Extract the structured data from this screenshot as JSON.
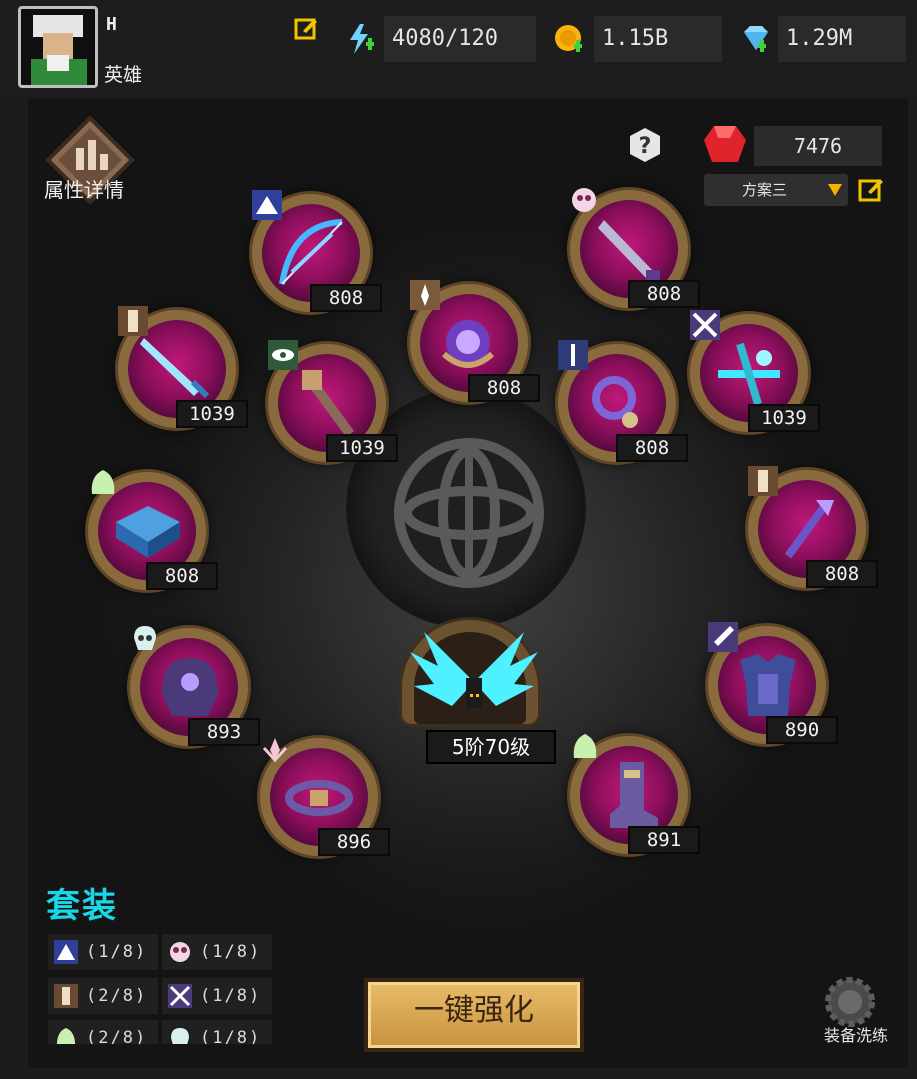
{
  "player": {
    "name": "H",
    "title": "英雄"
  },
  "resources": {
    "stamina": "4080/120",
    "gold": "1.15B",
    "diamonds": "1.29M"
  },
  "panel": {
    "attributes_label": "属性详情",
    "ruby_count": "7476",
    "plan_selected": "方案三"
  },
  "slots": [
    {
      "name": "bow",
      "level": "808"
    },
    {
      "name": "blade",
      "level": "808"
    },
    {
      "name": "sword",
      "level": "1039"
    },
    {
      "name": "crossbow",
      "level": "1039"
    },
    {
      "name": "orb",
      "level": "808"
    },
    {
      "name": "staff",
      "level": "1039"
    },
    {
      "name": "ring",
      "level": "808"
    },
    {
      "name": "book",
      "level": "808"
    },
    {
      "name": "scepter",
      "level": "808"
    },
    {
      "name": "helmet",
      "level": "893"
    },
    {
      "name": "armor",
      "level": "890"
    },
    {
      "name": "belt",
      "level": "896"
    },
    {
      "name": "boots",
      "level": "891"
    }
  ],
  "wings": {
    "level": "5阶70级"
  },
  "sets": {
    "title": "套装",
    "entries": [
      {
        "icon": "mountain-icon",
        "count": "(1/8)"
      },
      {
        "icon": "skull-sword-icon",
        "count": "(1/8)"
      },
      {
        "icon": "banner-icon",
        "count": "(2/8)"
      },
      {
        "icon": "crossed-swords-icon",
        "count": "(1/8)"
      },
      {
        "icon": "hood-icon",
        "count": "(2/8)"
      },
      {
        "icon": "skull-icon",
        "count": "(1/8)"
      }
    ]
  },
  "buttons": {
    "enhance": "一键强化",
    "wash": "装备洗练"
  },
  "colors": {
    "accent_cyan": "#18d7e6",
    "slot_magenta": "#c0187a",
    "gold_button": "#d9a752"
  }
}
